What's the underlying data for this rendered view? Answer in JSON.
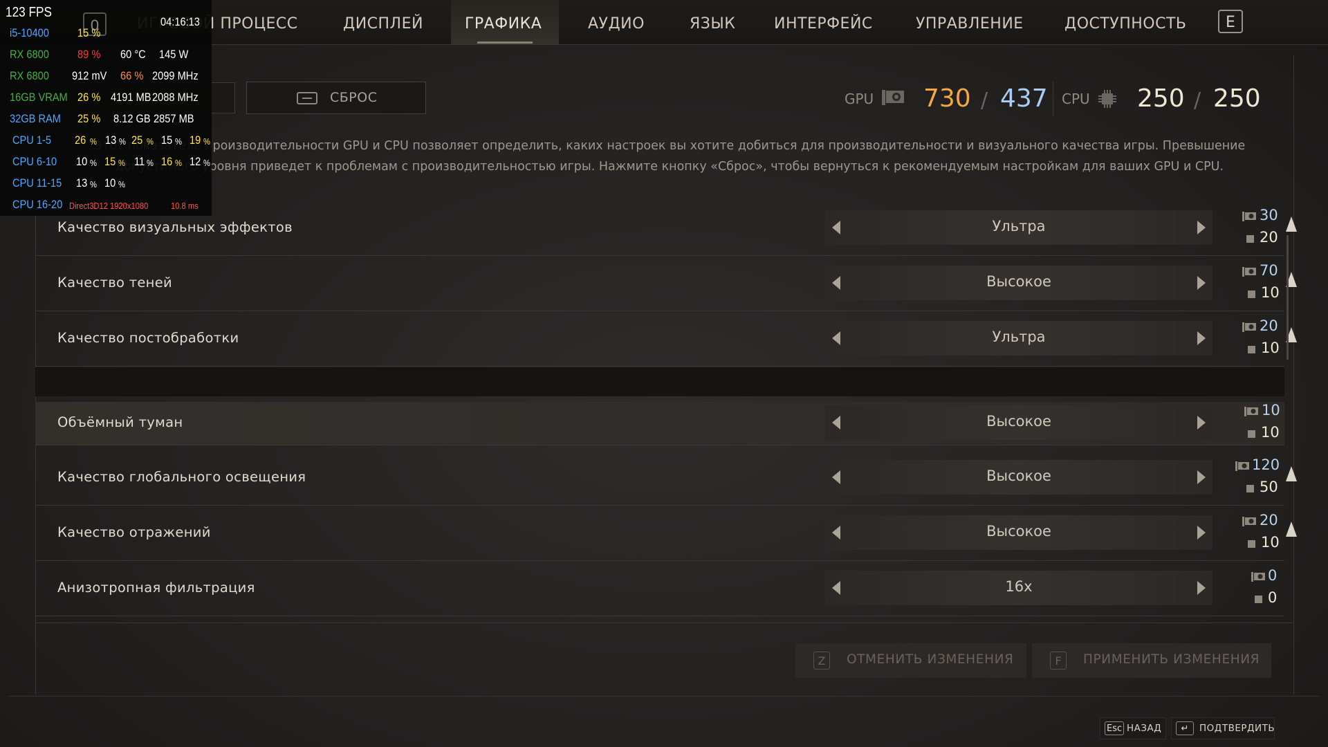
{
  "nav": {
    "tabs": [
      "ИГРОВОЙ ПРОЦЕСС",
      "ДИСПЛЕЙ",
      "ГРАФИКА",
      "АУДИО",
      "ЯЗЫК",
      "ИНТЕРФЕЙС",
      "УПРАВЛЕНИЕ",
      "ДОСТУПНОСТЬ"
    ],
    "active_tab": "ГРАФИКА",
    "next_key": "E"
  },
  "buttons": {
    "left_partial_label": "Е",
    "reset_label": "СБРОС"
  },
  "budget": {
    "gpu_label": "GPU",
    "gpu_used": "730",
    "gpu_max": "437",
    "cpu_label": "CPU",
    "cpu_used": "250",
    "cpu_max": "250",
    "separator": "/"
  },
  "description": "Этот показатель производительности GPU и CPU позволяет определить, каких настроек вы хотите добиться для производительности и визуального качества игры. Превышение допустимого уровня приведет к проблемам с производительностью игры. Нажмите кнопку «Сброс», чтобы вернуться к рекомендуемым настройкам для ваших GPU и CPU.",
  "settings": [
    {
      "label": "Качество визуальных эффектов",
      "value": "Ультра",
      "gpu": "30",
      "cpu": "20",
      "warning": true
    },
    {
      "label": "Качество теней",
      "value": "Высокое",
      "gpu": "70",
      "cpu": "10",
      "warning": true
    },
    {
      "label": "Качество постобработки",
      "value": "Ультра",
      "gpu": "20",
      "cpu": "10",
      "warning": true
    },
    {
      "label": "Объёмный туман",
      "value": "Высокое",
      "gpu": "10",
      "cpu": "10",
      "warning": false
    },
    {
      "label": "Качество глобального освещения",
      "value": "Высокое",
      "gpu": "120",
      "cpu": "50",
      "warning": true
    },
    {
      "label": "Качество отражений",
      "value": "Высокое",
      "gpu": "20",
      "cpu": "10",
      "warning": true
    },
    {
      "label": "Анизотропная фильтрация",
      "value": "16x",
      "gpu": "0",
      "cpu": "0",
      "warning": false
    }
  ],
  "footer": {
    "cancel_key": "Z",
    "cancel_label": "ОТМЕНИТЬ ИЗМЕНЕНИЯ",
    "apply_key": "F",
    "apply_label": "ПРИМЕНИТЬ ИЗМЕНЕНИЯ"
  },
  "hints": {
    "back_key": "Esc",
    "back_label": "НАЗАД",
    "confirm_key": "↵",
    "confirm_label": "ПОДТВЕРДИТЬ"
  },
  "overlay": {
    "fps": "123 FPS",
    "badge": "0",
    "clock": "04:16:13",
    "cpu_name": "i5-10400",
    "cpu_load": "15 %",
    "gpu_name": "RX 6800",
    "gpu_load": "89 %",
    "gpu_temp": "60 °C",
    "gpu_power": "145 W",
    "gpu_name2": "RX 6800",
    "gpu_voltage": "912 mV",
    "gpu_fan": "66 %",
    "gpu_clock": "2099 MHz",
    "vram_name": "16GB VRAM",
    "vram_load": "26 %",
    "vram_used": "4191 MB",
    "vram_clock": "2088 MHz",
    "ram_name": "32GB RAM",
    "ram_load": "25 %",
    "ram_used": "8.12 GB",
    "ram_pagefile": "2857 MB",
    "cpu_1_5_label": "CPU 1-5",
    "cpu_1_5": [
      "26",
      "13",
      "25",
      "15",
      "19"
    ],
    "cpu_6_10_label": "CPU 6-10",
    "cpu_6_10": [
      "10",
      "15",
      "11",
      "16",
      "12"
    ],
    "cpu_11_15_label": "CPU 11-15",
    "cpu_11_15": [
      "13",
      "10"
    ],
    "cpu_16_20_label": "CPU 16-20",
    "api": "Direct3D12 1920x1080",
    "frametime": "10.8 ms",
    "pct": "%"
  }
}
